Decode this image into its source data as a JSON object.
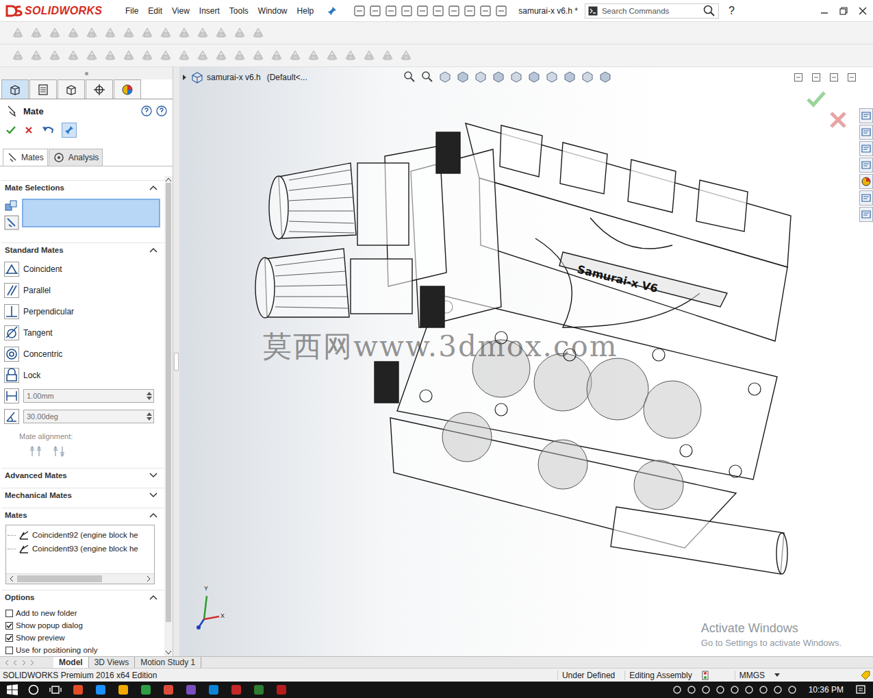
{
  "app": {
    "logo": "SOLIDWORKS",
    "document_title": "samurai-x v6.h *",
    "help": "?"
  },
  "menu": [
    "File",
    "Edit",
    "View",
    "Insert",
    "Tools",
    "Window",
    "Help"
  ],
  "search": {
    "placeholder": "Search Commands"
  },
  "property_manager": {
    "title": "Mate",
    "tabs": [
      {
        "label": "Mates",
        "selected": true
      },
      {
        "label": "Analysis",
        "selected": false
      }
    ],
    "mate_selections": {
      "title": "Mate Selections",
      "expanded": true
    },
    "standard_mates": {
      "title": "Standard Mates",
      "expanded": true,
      "items": [
        {
          "label": "Coincident"
        },
        {
          "label": "Parallel"
        },
        {
          "label": "Perpendicular"
        },
        {
          "label": "Tangent"
        },
        {
          "label": "Concentric"
        },
        {
          "label": "Lock"
        }
      ],
      "distance": {
        "value": "1.00mm",
        "disabled": true
      },
      "angle": {
        "value": "30.00deg",
        "disabled": true
      },
      "alignment_label": "Mate alignment:"
    },
    "collapsed_sections": [
      {
        "title": "Advanced Mates",
        "expanded": false
      },
      {
        "title": "Mechanical Mates",
        "expanded": false
      }
    ],
    "mates": {
      "title": "Mates",
      "expanded": true,
      "items": [
        "Coincident92 (engine block he",
        "Coincident93 (engine block he"
      ]
    },
    "options": {
      "title": "Options",
      "expanded": true,
      "items": [
        {
          "label": "Add to new folder",
          "checked": false
        },
        {
          "label": "Show popup dialog",
          "checked": true
        },
        {
          "label": "Show preview",
          "checked": true
        },
        {
          "label": "Use for positioning only",
          "checked": false
        }
      ]
    }
  },
  "viewport": {
    "document": "samurai-x v6.h",
    "configuration": "(Default<...",
    "model_label": "Samurai-x V6",
    "axes": [
      "Y",
      "X"
    ],
    "watermark": "莫西网www.3dmox.com"
  },
  "activation": {
    "title": "Activate Windows",
    "subtitle": "Go to Settings to activate Windows."
  },
  "bottom_tabs": [
    {
      "label": "Model",
      "selected": true
    },
    {
      "label": "3D Views",
      "selected": false
    },
    {
      "label": "Motion Study 1",
      "selected": false
    }
  ],
  "status_bar": {
    "edition": "SOLIDWORKS Premium 2016 x64 Edition",
    "state": "Under Defined",
    "mode": "Editing Assembly",
    "units": "MMGS"
  },
  "taskbar": {
    "time": "10:36 PM"
  }
}
